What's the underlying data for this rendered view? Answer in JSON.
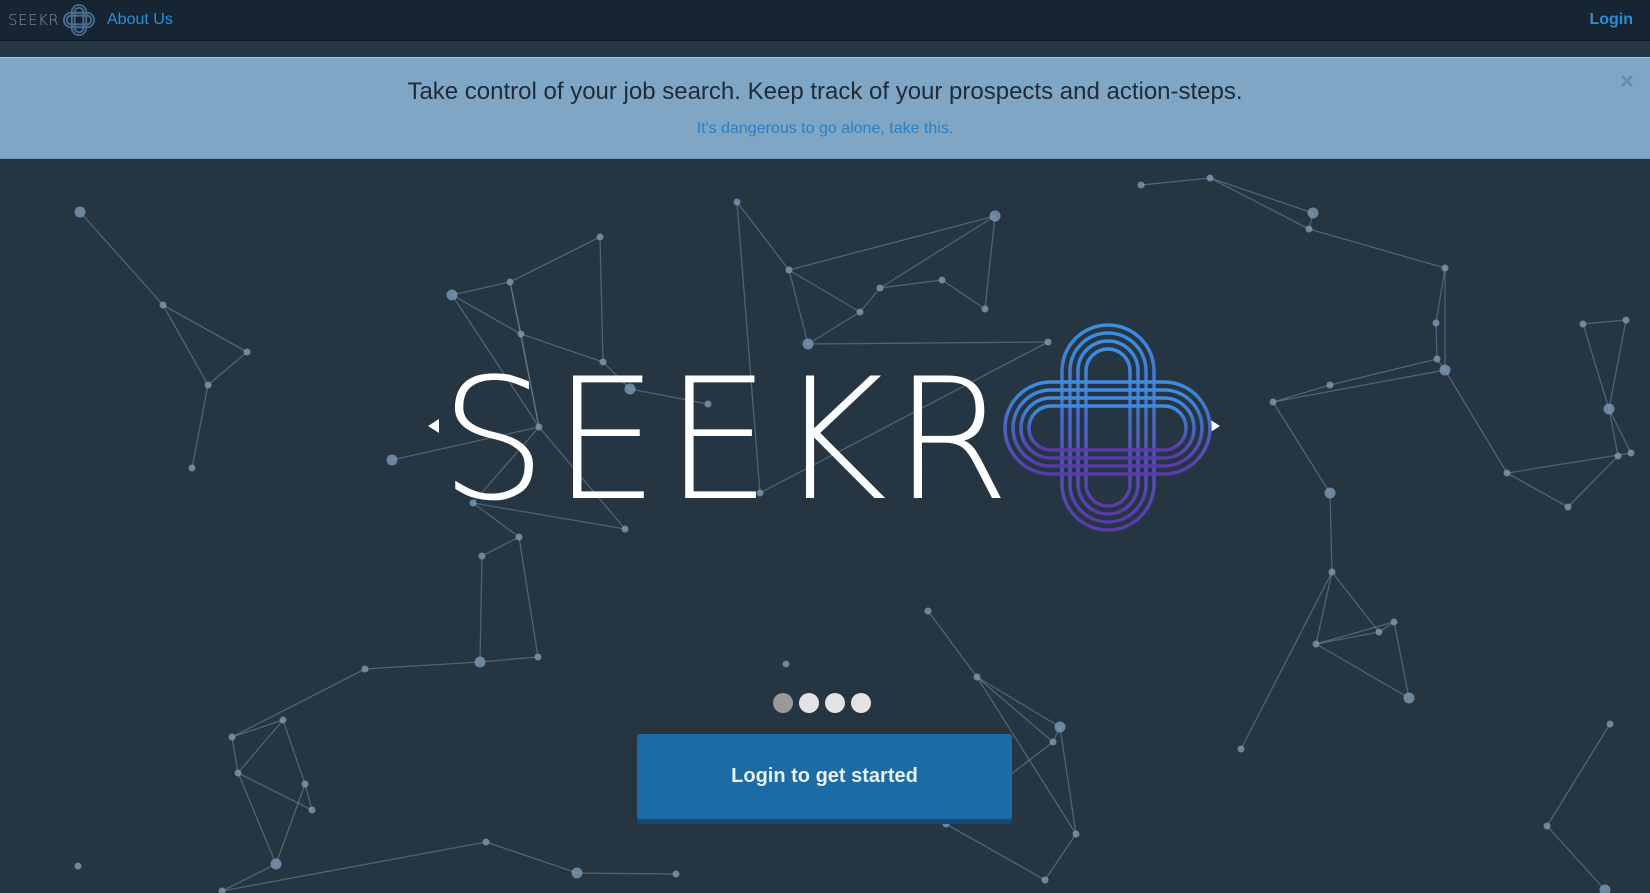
{
  "nav": {
    "logo_text": "SEEKR",
    "about_label": "About Us",
    "login_label": "Login"
  },
  "banner": {
    "headline": "Take control of your job search. Keep track of your prospects and action-steps.",
    "subtext": "It's dangerous to go alone, take this.",
    "close_glyph": "×"
  },
  "hero": {
    "logo_text": "SEEKR",
    "carousel": {
      "slide_count": 4,
      "active_index": 0
    }
  },
  "cta": {
    "label": "Login to get started"
  },
  "colors": {
    "background": "#263542",
    "nav_background": "#172431",
    "accent_link": "#2a8fd6",
    "banner_background": "#89b3d4",
    "button": "#1c6ba4",
    "logo_mark_start": "#3a8fe0",
    "logo_mark_end": "#5a3aa8"
  },
  "icons": {
    "close": "close-icon",
    "prev": "caret-left-icon",
    "next": "caret-right-icon",
    "logo_mark": "celtic-knot-logo"
  }
}
